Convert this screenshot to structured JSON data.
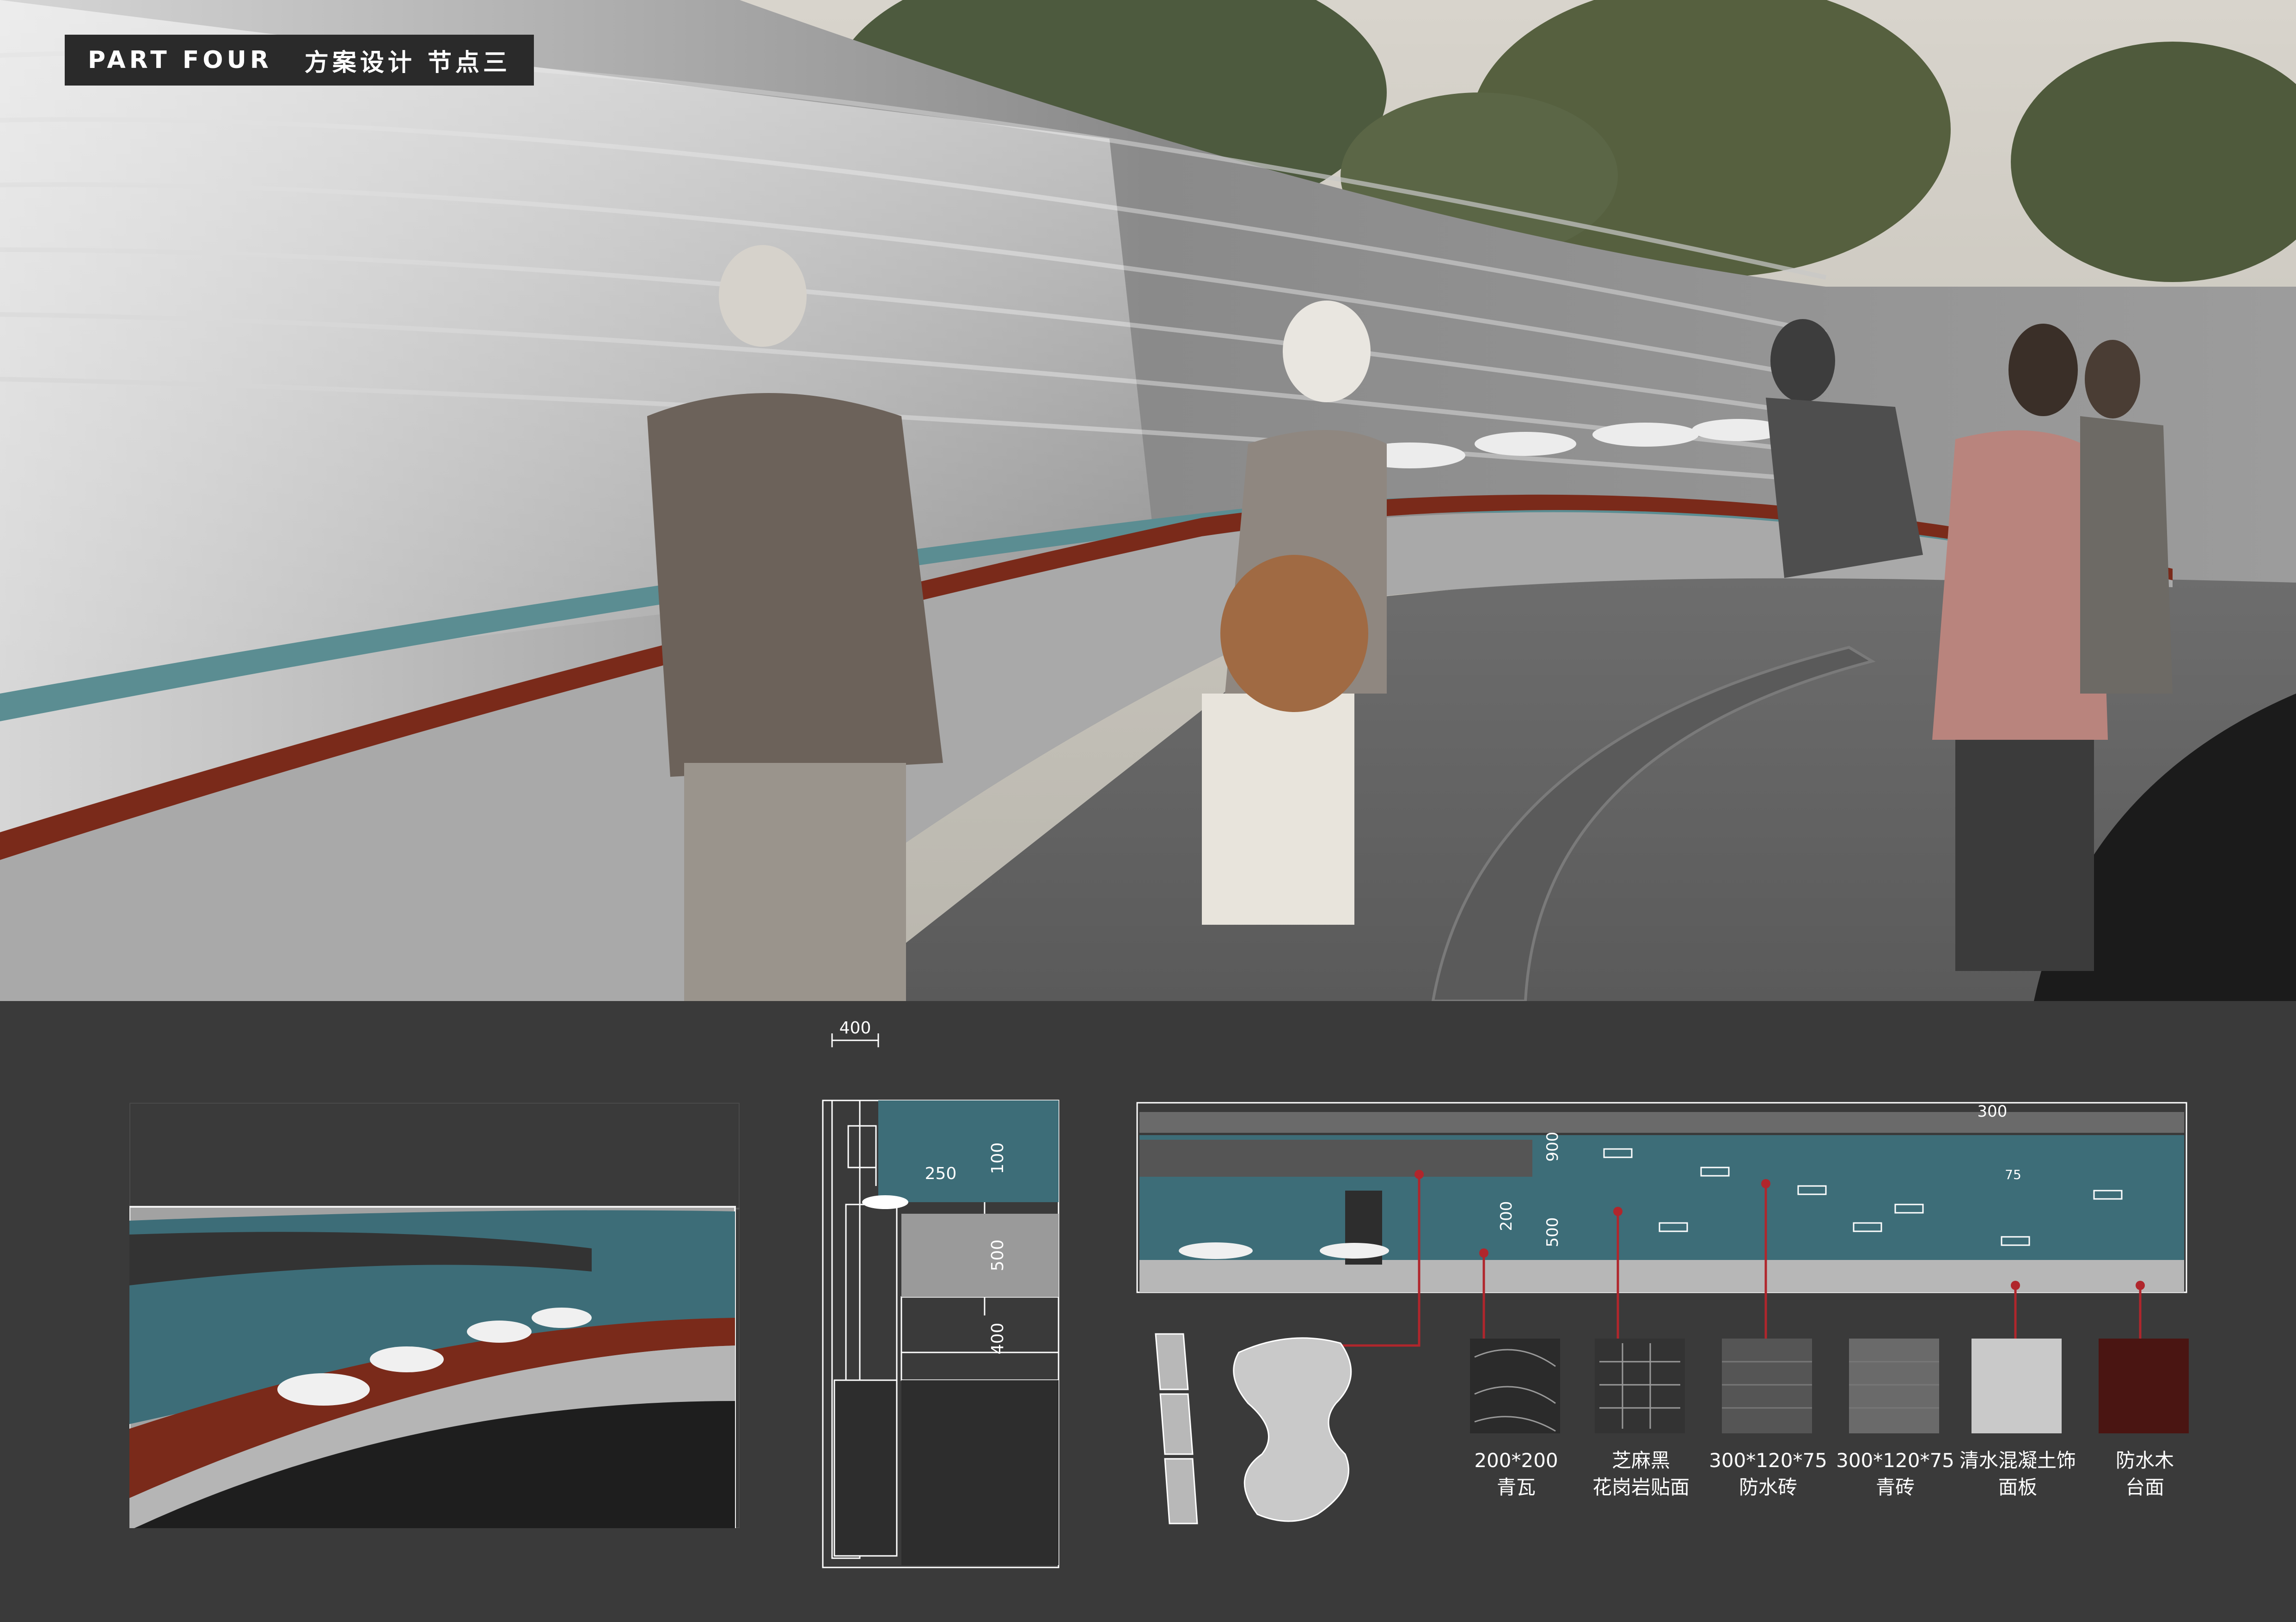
{
  "header": {
    "part": "PART FOUR",
    "subtitle": "方案设计  节点三"
  },
  "section_dims": {
    "top_width": "400",
    "basin_width": "250",
    "h1": "100",
    "h2": "500",
    "h3": "400"
  },
  "elevation_dims": {
    "tile_len": "300",
    "h_900": "900",
    "h_200": "200",
    "h_500": "500",
    "small": "75"
  },
  "materials": [
    {
      "line1": "200*200",
      "line2": "青瓦",
      "color": "#2b2b2b"
    },
    {
      "line1": "芝麻黑",
      "line2": "花岗岩贴面",
      "color": "#333333"
    },
    {
      "line1": "300*120*75",
      "line2": "防水砖",
      "color": "#555555"
    },
    {
      "line1": "300*120*75",
      "line2": "青砖",
      "color": "#6a6a6a"
    },
    {
      "line1": "清水混凝土饰",
      "line2": "面板",
      "color": "#c9c9c9"
    },
    {
      "line1": "防水木",
      "line2": "台面",
      "color": "#4a1512"
    }
  ],
  "colors": {
    "accent_red": "#b0262c",
    "teal": "#3d6d78",
    "wood": "#7a2a1a"
  }
}
